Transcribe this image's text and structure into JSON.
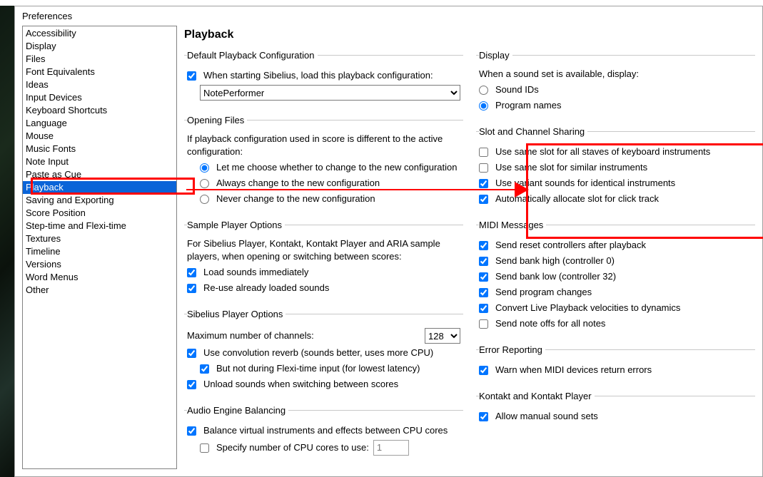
{
  "window": {
    "title": "Preferences"
  },
  "categories": [
    "Accessibility",
    "Display",
    "Files",
    "Font Equivalents",
    "Ideas",
    "Input Devices",
    "Keyboard Shortcuts",
    "Language",
    "Mouse",
    "Music Fonts",
    "Note Input",
    "Paste as Cue",
    "Playback",
    "Saving and Exporting",
    "Score Position",
    "Step-time and Flexi-time",
    "Textures",
    "Timeline",
    "Versions",
    "Word Menus",
    "Other"
  ],
  "selected_category_index": 12,
  "page_title": "Playback",
  "left": {
    "default_config": {
      "legend": "Default Playback Configuration",
      "load_on_start_label": "When starting Sibelius, load this playback configuration:",
      "load_on_start_checked": true,
      "config_selected": "NotePerformer"
    },
    "opening_files": {
      "legend": "Opening Files",
      "intro": "If playback configuration used in score is different to the active configuration:",
      "opt_choose": "Let me choose whether to change to the new configuration",
      "opt_always": "Always change to the new configuration",
      "opt_never": "Never change to the new configuration",
      "selected": "choose"
    },
    "sample_player": {
      "legend": "Sample Player Options",
      "intro": "For Sibelius Player, Kontakt, Kontakt Player and ARIA sample players, when opening or switching between scores:",
      "load_immediately_label": "Load sounds immediately",
      "load_immediately_checked": true,
      "reuse_label": "Re-use already loaded sounds",
      "reuse_checked": true
    },
    "sib_player": {
      "legend": "Sibelius Player Options",
      "max_channels_label": "Maximum number of channels:",
      "max_channels_value": "128",
      "conv_reverb_label": "Use convolution reverb (sounds better, uses more CPU)",
      "conv_reverb_checked": true,
      "not_flexi_label": "But not during Flexi-time input (for lowest latency)",
      "not_flexi_checked": true,
      "unload_label": "Unload sounds when switching between scores",
      "unload_checked": true
    },
    "audio_engine": {
      "legend": "Audio Engine Balancing",
      "balance_label": "Balance virtual instruments and effects between CPU cores",
      "balance_checked": true,
      "specify_label": "Specify number of CPU cores to use:",
      "specify_checked": false,
      "specify_value": "1"
    }
  },
  "right": {
    "display": {
      "legend": "Display",
      "intro": "When a sound set is available, display:",
      "opt_soundids": "Sound IDs",
      "opt_prognames": "Program names",
      "selected": "prognames"
    },
    "slot": {
      "legend": "Slot and Channel Sharing",
      "same_keyboard_label": "Use same slot for all staves of keyboard instruments",
      "same_keyboard_checked": false,
      "same_similar_label": "Use same slot for similar instruments",
      "same_similar_checked": false,
      "variant_label": "Use variant sounds for identical instruments",
      "variant_checked": true,
      "click_label": "Automatically allocate slot for click track",
      "click_checked": true
    },
    "midi": {
      "legend": "MIDI Messages",
      "reset_label": "Send reset controllers after playback",
      "reset_checked": true,
      "bank_high_label": "Send bank high (controller 0)",
      "bank_high_checked": true,
      "bank_low_label": "Send bank low (controller 32)",
      "bank_low_checked": true,
      "prog_label": "Send program changes",
      "prog_checked": true,
      "convert_label": "Convert Live Playback velocities to dynamics",
      "convert_checked": true,
      "noteoff_label": "Send note offs for all notes",
      "noteoff_checked": false
    },
    "error": {
      "legend": "Error Reporting",
      "warn_label": "Warn when MIDI devices return errors",
      "warn_checked": true
    },
    "kontakt": {
      "legend": "Kontakt and Kontakt Player",
      "allow_label": "Allow manual sound sets",
      "allow_checked": true
    }
  }
}
